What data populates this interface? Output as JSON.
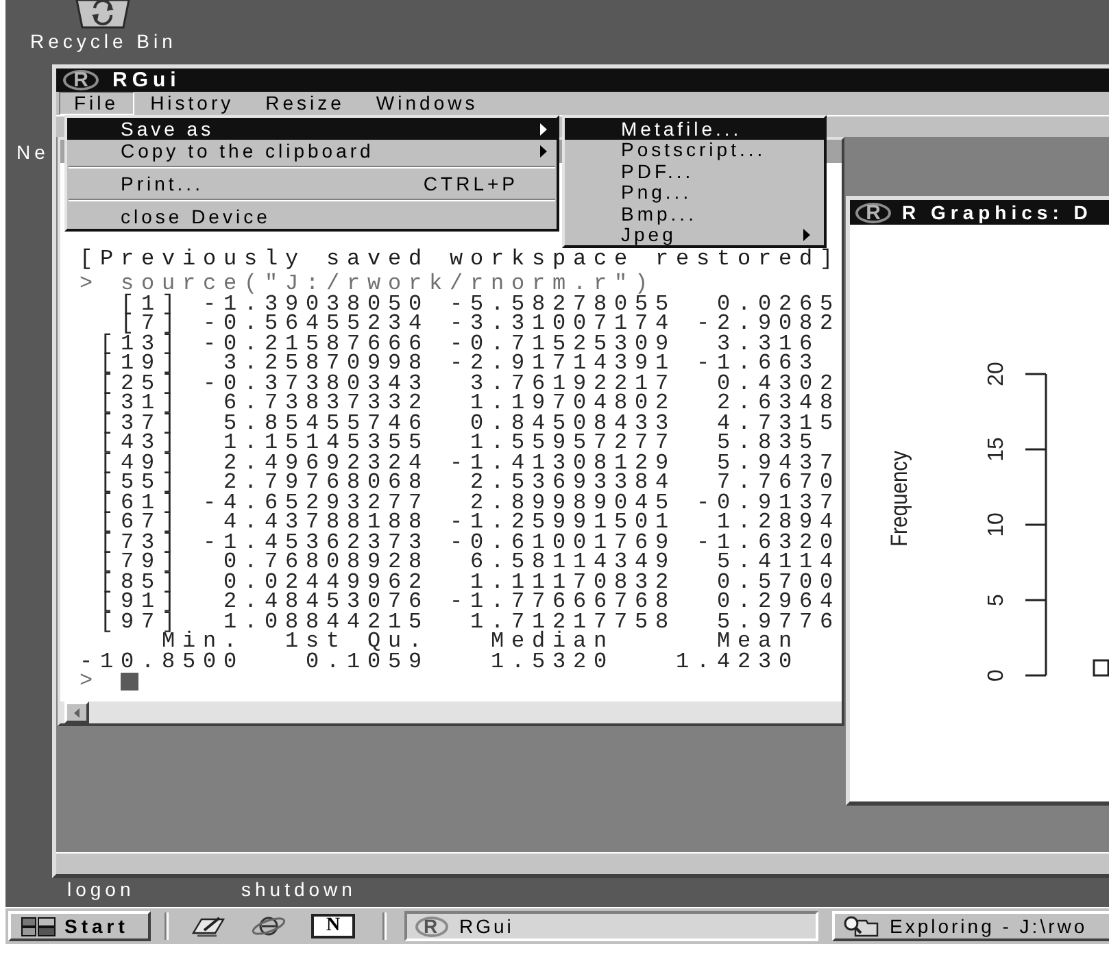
{
  "desktop": {
    "recycle_bin": {
      "label": "Recycle Bin"
    },
    "left_icon_labels": [
      "Ne"
    ],
    "bottom_icon_labels": [
      "logon",
      "shutdown"
    ]
  },
  "rgui": {
    "title": "RGui",
    "logo": "R",
    "menu": [
      {
        "label": "File",
        "selected": true
      },
      {
        "label": "History",
        "selected": false
      },
      {
        "label": "Resize",
        "selected": false
      },
      {
        "label": "Windows",
        "selected": false
      }
    ],
    "file_menu": [
      {
        "kind": "item",
        "label": "Save as",
        "submenu": true,
        "selected": true
      },
      {
        "kind": "item",
        "label": "Copy to the clipboard",
        "submenu": true,
        "selected": false
      },
      {
        "kind": "separator"
      },
      {
        "kind": "item",
        "label": "Print...",
        "shortcut": "CTRL+P",
        "submenu": false,
        "selected": false
      },
      {
        "kind": "separator"
      },
      {
        "kind": "item",
        "label": "close Device",
        "submenu": false,
        "selected": false
      }
    ],
    "save_as_menu": [
      {
        "label": "Metafile...",
        "submenu": false,
        "selected": true
      },
      {
        "label": "Postscript...",
        "submenu": false,
        "selected": false
      },
      {
        "label": "PDF...",
        "submenu": false,
        "selected": false
      },
      {
        "label": "Png...",
        "submenu": false,
        "selected": false
      },
      {
        "label": "Bmp...",
        "submenu": false,
        "selected": false
      },
      {
        "label": "Jpeg",
        "submenu": true,
        "selected": false
      }
    ],
    "console": {
      "lines": [
        {
          "kind": "message",
          "text": "[Previously saved workspace restored]"
        },
        {
          "kind": "input",
          "text": "> source(\"J:/rwork/rnorm.r\")"
        },
        {
          "kind": "output",
          "text": "  [1] -1.39038050 -5.58278055  0.0265"
        },
        {
          "kind": "output",
          "text": "  [7] -0.56455234 -3.31007174 -2.9082"
        },
        {
          "kind": "output",
          "text": " [13] -0.21587666 -0.71525309  3.316"
        },
        {
          "kind": "output",
          "text": " [19]  3.25870998 -2.91714391 -1.663"
        },
        {
          "kind": "output",
          "text": " [25] -0.37380343  3.76192217  0.4302"
        },
        {
          "kind": "output",
          "text": " [31]  6.73837332  1.19704802  2.6348"
        },
        {
          "kind": "output",
          "text": " [37]  5.85455746  0.84508433  4.7315"
        },
        {
          "kind": "output",
          "text": " [43]  1.15145355  1.55957277  5.835"
        },
        {
          "kind": "output",
          "text": " [49]  2.49692324 -1.41308129  5.9437"
        },
        {
          "kind": "output",
          "text": " [55]  2.79768068  2.53693384  7.7670"
        },
        {
          "kind": "output",
          "text": " [61] -4.65293277  2.89989045 -0.9137"
        },
        {
          "kind": "output",
          "text": " [67]  4.43788188 -1.25991501  1.2894"
        },
        {
          "kind": "output",
          "text": " [73] -1.45362373 -0.61001769 -1.6320"
        },
        {
          "kind": "output",
          "text": " [79]  0.76808928  6.58114349  5.4114"
        },
        {
          "kind": "output",
          "text": " [85]  0.02449962  1.11170832  0.5700"
        },
        {
          "kind": "output",
          "text": " [91]  2.48453076 -1.77666768  0.2964"
        },
        {
          "kind": "output",
          "text": " [97]  1.08844215  1.71217758  5.9776"
        },
        {
          "kind": "output",
          "text": "    Min.  1st Qu.   Median     Mean"
        },
        {
          "kind": "output",
          "text": "-10.8500   0.1059   1.5320   1.4230"
        },
        {
          "kind": "prompt",
          "text": ">"
        }
      ]
    },
    "graphics_window": {
      "title": "R Graphics: D",
      "logo": "R",
      "plot": {
        "y_axis_title": "Frequency",
        "y_tick_labels": [
          "0",
          "5",
          "10",
          "15",
          "20"
        ]
      }
    }
  },
  "taskbar": {
    "start": "Start",
    "quick_launch": [
      {
        "kind": "desktop"
      },
      {
        "kind": "browser"
      },
      {
        "kind": "app",
        "glyph": "N"
      }
    ],
    "tasks": [
      {
        "kind": "r",
        "logo": "R",
        "label": "RGui",
        "selected": true
      },
      {
        "kind": "explorer",
        "label": "Exploring - J:\\rwo",
        "selected": false
      }
    ]
  }
}
